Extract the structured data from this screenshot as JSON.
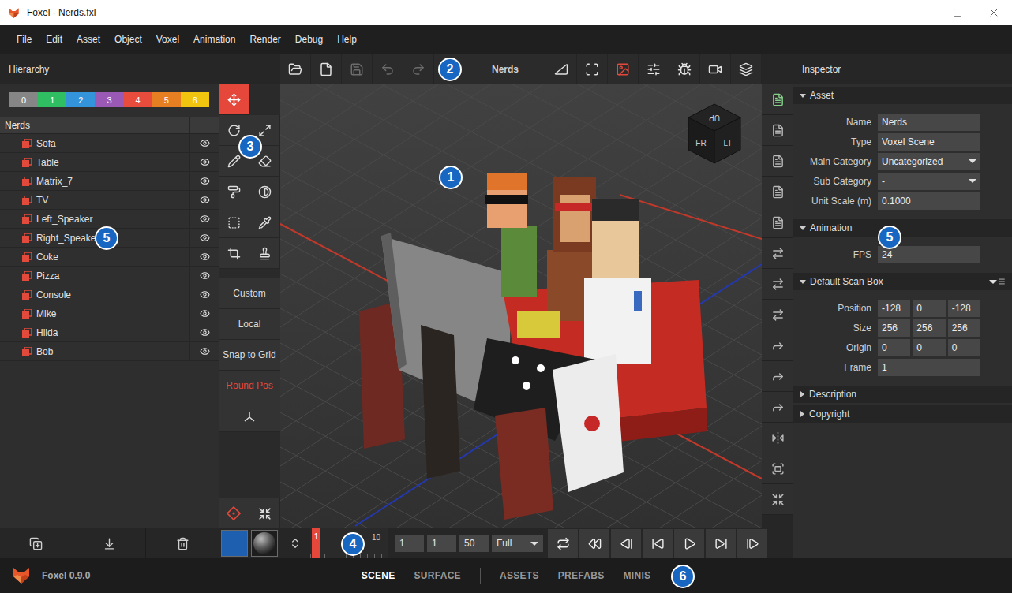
{
  "window": {
    "title": "Foxel - Nerds.fxl"
  },
  "menu": [
    "File",
    "Edit",
    "Asset",
    "Object",
    "Voxel",
    "Animation",
    "Render",
    "Debug",
    "Help"
  ],
  "hierarchy": {
    "title": "Hierarchy",
    "layers": [
      {
        "label": "0",
        "color": "#868686"
      },
      {
        "label": "1",
        "color": "#2fbf62"
      },
      {
        "label": "2",
        "color": "#3393db"
      },
      {
        "label": "3",
        "color": "#9b59b6"
      },
      {
        "label": "4",
        "color": "#e74c3c"
      },
      {
        "label": "5",
        "color": "#e67e22"
      },
      {
        "label": "6",
        "color": "#f1c40f"
      }
    ],
    "root": "Nerds",
    "items": [
      {
        "name": "Sofa",
        "visible": true
      },
      {
        "name": "Table",
        "visible": true
      },
      {
        "name": "Matrix_7",
        "visible": true
      },
      {
        "name": "TV",
        "visible": true
      },
      {
        "name": "Left_Speaker",
        "visible": true
      },
      {
        "name": "Right_Speaker",
        "visible": true
      },
      {
        "name": "Coke",
        "visible": true
      },
      {
        "name": "Pizza",
        "visible": true
      },
      {
        "name": "Console",
        "visible": true
      },
      {
        "name": "Mike",
        "visible": true
      },
      {
        "name": "Hilda",
        "visible": true
      },
      {
        "name": "Bob",
        "visible": true
      }
    ]
  },
  "tools": [
    {
      "selected": true
    },
    {
      "selected": false
    },
    {
      "selected": false
    },
    {
      "selected": false
    },
    {
      "selected": false
    },
    {
      "selected": false
    },
    {
      "selected": false
    },
    {
      "selected": false
    },
    {
      "selected": false
    },
    {
      "selected": false
    },
    {
      "selected": false
    }
  ],
  "tool_options": [
    {
      "label": "Custom",
      "active": false
    },
    {
      "label": "Local",
      "active": false
    },
    {
      "label": "Snap to Grid",
      "active": false
    },
    {
      "label": "Round Pos",
      "active": true
    }
  ],
  "pivot_tools": [
    {
      "selected": true
    },
    {
      "selected": false
    }
  ],
  "swatch_color": "#1f5faf",
  "toolbar": {
    "title": "Nerds",
    "file_buttons": [
      {
        "disabled": false
      },
      {
        "disabled": false
      },
      {
        "disabled": true
      },
      {
        "disabled": true
      },
      {
        "disabled": true
      }
    ],
    "view_buttons": [
      {
        "active": false
      },
      {
        "active": false
      },
      {
        "active": true
      },
      {
        "active": false
      },
      {
        "active": false
      },
      {
        "active": false
      },
      {
        "active": false
      }
    ]
  },
  "viewport": {
    "cube": {
      "top": "UP",
      "front": "FR",
      "side": "LT"
    }
  },
  "side_tools": [
    {
      "active": true
    },
    {
      "active": false
    },
    {
      "active": false
    },
    {
      "active": false
    },
    {
      "active": false
    },
    {
      "active": false
    },
    {
      "active": false
    },
    {
      "active": false
    },
    {
      "active": false
    },
    {
      "active": false
    },
    {
      "active": false
    },
    {
      "active": false
    },
    {
      "active": false
    },
    {
      "active": false
    }
  ],
  "timeline": {
    "current_frame": "1",
    "ruler_label": "10",
    "fields": [
      "1",
      "1",
      "50"
    ],
    "range": "Full"
  },
  "inspector": {
    "title": "Inspector",
    "sections": [
      {
        "title": "Asset",
        "expanded": true,
        "has_menu": false,
        "fields": [
          {
            "label": "Name",
            "kind": "text",
            "values": [
              "Nerds"
            ]
          },
          {
            "label": "Type",
            "kind": "text",
            "values": [
              "Voxel Scene"
            ]
          },
          {
            "label": "Main Category",
            "kind": "select",
            "values": [
              "Uncategorized"
            ]
          },
          {
            "label": "Sub Category",
            "kind": "select",
            "values": [
              "-"
            ]
          },
          {
            "label": "Unit Scale (m)",
            "kind": "text",
            "values": [
              "0.1000"
            ]
          }
        ]
      },
      {
        "title": "Animation",
        "expanded": true,
        "has_menu": false,
        "fields": [
          {
            "label": "FPS",
            "kind": "text",
            "values": [
              "24"
            ]
          }
        ]
      },
      {
        "title": "Default Scan Box",
        "expanded": true,
        "has_menu": true,
        "fields": [
          {
            "label": "Position",
            "kind": "vector",
            "values": [
              "-128",
              "0",
              "-128"
            ]
          },
          {
            "label": "Size",
            "kind": "vector",
            "values": [
              "256",
              "256",
              "256"
            ]
          },
          {
            "label": "Origin",
            "kind": "vector",
            "values": [
              "0",
              "0",
              "0"
            ]
          },
          {
            "label": "Frame",
            "kind": "text",
            "values": [
              "1"
            ]
          }
        ]
      },
      {
        "title": "Description",
        "expanded": false,
        "has_menu": false,
        "fields": []
      },
      {
        "title": "Copyright",
        "expanded": false,
        "has_menu": false,
        "fields": []
      }
    ]
  },
  "status_bar": {
    "version": "Foxel 0.9.0",
    "tab_groups": [
      [
        {
          "label": "SCENE",
          "selected": true
        },
        {
          "label": "SURFACE",
          "selected": false
        }
      ],
      [
        {
          "label": "ASSETS",
          "selected": false
        },
        {
          "label": "PREFABS",
          "selected": false
        },
        {
          "label": "MINIS",
          "selected": false
        }
      ]
    ]
  },
  "annotations": [
    "1",
    "2",
    "3",
    "4",
    "5",
    "5",
    "6"
  ]
}
